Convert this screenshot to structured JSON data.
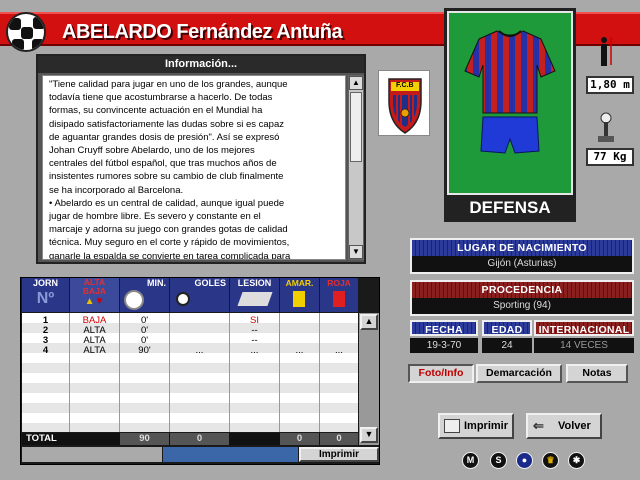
{
  "player": {
    "name": "ABELARDO Fernández Antuña",
    "position": "DEFENSA",
    "height": "1,80 m",
    "weight": "77 Kg"
  },
  "crest": {
    "text": "F.C.B"
  },
  "info": {
    "title": "Información...",
    "lines": [
      "\"Tiene calidad para jugar en uno de los grandes, aunque",
      "todavía tiene que acostumbrarse a hacerlo. De todas",
      "formas, su convincente actuación en el Mundial ha",
      "disipado satisfactoriamente las dudas sobre si es capaz",
      "de aguantar grandes dosis de presión\". Así se expresó",
      "Johan Cruyff sobre Abelardo, uno de los mejores",
      "centrales del fútbol español, que tras muchos años de",
      "insistentes rumores sobre su cambio de club finalmente",
      "se ha incorporado al Barcelona.",
      " • Abelardo es un central de calidad, aunque igual puede",
      "jugar de hombre libre. Es severo y constante en el",
      "marcaje y adorna su juego con grandes gotas de calidad",
      "técnica. Muy seguro en el corte y rápido de movimientos,",
      "ganarle la espalda se convierte en tarea complicada para"
    ]
  },
  "birth": {
    "label": "LUGAR DE NACIMIENTO",
    "value": "Gijón (Asturias)"
  },
  "origin": {
    "label": "PROCEDENCIA",
    "value": "Sporting (94)"
  },
  "details": {
    "fecha_label": "FECHA",
    "fecha": "19-3-70",
    "edad_label": "EDAD",
    "edad": "24",
    "intl_label": "INTERNACIONAL",
    "intl": "14 VECES"
  },
  "tabs": {
    "foto": "Foto/Info",
    "demarcacion": "Demarcación",
    "notas": "Notas"
  },
  "table": {
    "headers": {
      "jorn": "JORN",
      "num": "Nº",
      "alta": "ALTA BAJA",
      "min": "MIN.",
      "goles": "GOLES",
      "lesion": "LESION",
      "amar": "AMAR.",
      "roja": "ROJA"
    },
    "rows": [
      {
        "jorn": "1",
        "alta": "BAJA",
        "min": "0'",
        "goles": "",
        "lesion": "SI",
        "amar": "",
        "roja": ""
      },
      {
        "jorn": "2",
        "alta": "ALTA",
        "min": "0'",
        "goles": "",
        "lesion": "--",
        "amar": "",
        "roja": ""
      },
      {
        "jorn": "3",
        "alta": "ALTA",
        "min": "0'",
        "goles": "",
        "lesion": "--",
        "amar": "",
        "roja": ""
      },
      {
        "jorn": "4",
        "alta": "ALTA",
        "min": "90'",
        "goles": "...",
        "lesion": "...",
        "amar": "...",
        "roja": "..."
      }
    ],
    "total_label": "TOTAL",
    "total_min": "90",
    "total_goles": "0",
    "total_amar": "0",
    "total_roja": "0",
    "print_label": "Imprimir"
  },
  "buttons": {
    "imprimir": "Imprimir",
    "volver": "Volver"
  },
  "bottom_icons": [
    "M",
    "S"
  ],
  "colors": {
    "header_red": "#d21010",
    "pitch_green": "#1e9a3a",
    "alta_red": "#d00000"
  }
}
